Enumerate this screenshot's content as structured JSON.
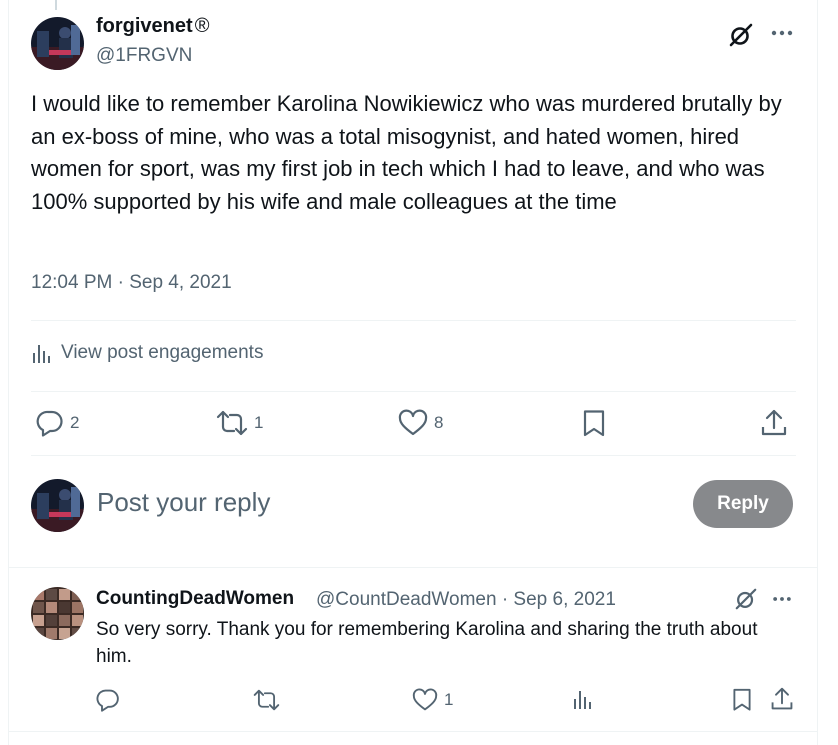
{
  "post": {
    "author_name": "forgivenet",
    "author_badge": "®",
    "author_handle": "@1FRGVN",
    "text": "I would like to remember Karolina Nowikiewicz who was murdered brutally by an ex-boss of mine, who was a total misogynist, and hated women, hired women for sport, was my first job in tech which I had to leave, and who was 100% supported by his wife and male colleagues at the time",
    "timestamp": "12:04 PM · Sep 4, 2021",
    "engagements_label": "View post engagements",
    "stats": {
      "replies": "2",
      "reposts": "1",
      "likes": "8"
    },
    "icons": [
      "grok-icon",
      "more-icon",
      "analytics-icon",
      "reply-icon",
      "repost-icon",
      "like-icon",
      "bookmark-icon",
      "share-icon"
    ]
  },
  "composer": {
    "placeholder": "Post your reply",
    "button_label": "Reply"
  },
  "reply": {
    "author_name": "CountingDeadWomen",
    "author_handle": "@CountDeadWomen",
    "date": "Sep 6, 2021",
    "separator": "·",
    "text": "So very sorry. Thank you for remembering Karolina and sharing the truth about him.",
    "stats": {
      "likes": "1"
    }
  },
  "colors": {
    "text": "#0f1419",
    "secondary": "#536471",
    "border": "#eff3f4",
    "reply_button": "#87898c"
  }
}
